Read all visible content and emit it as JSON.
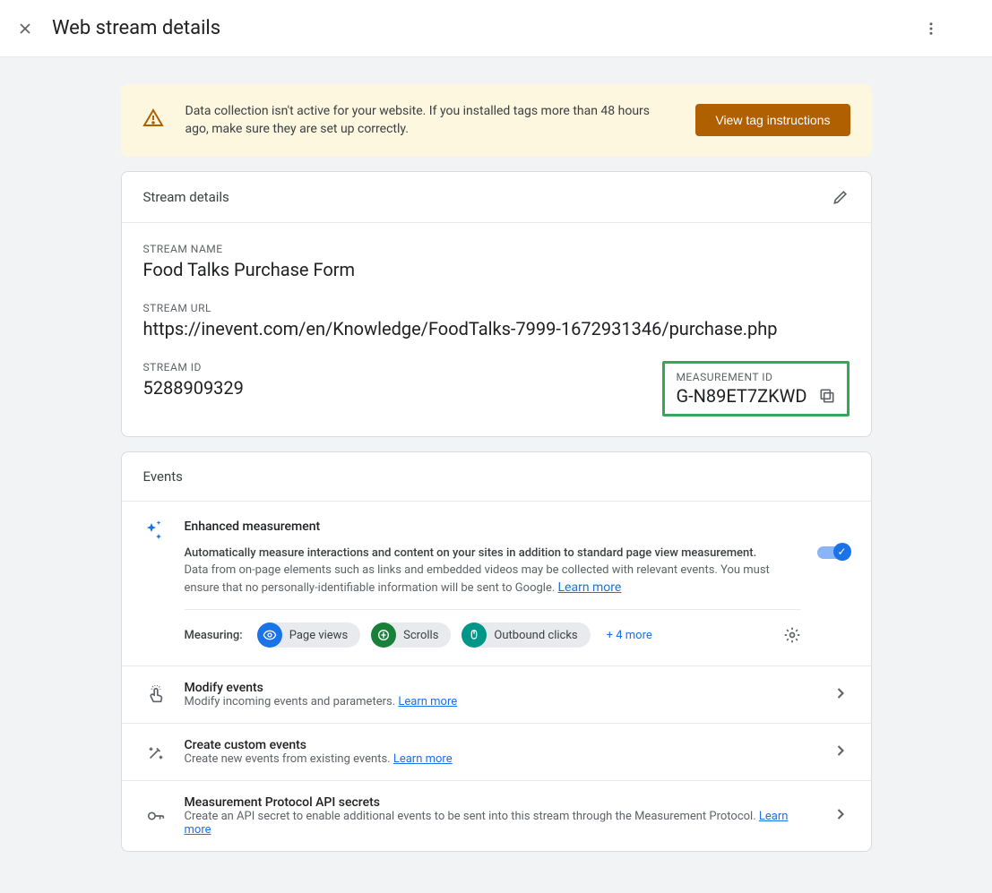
{
  "header": {
    "title": "Web stream details"
  },
  "alert": {
    "text": "Data collection isn't active for your website. If you installed tags more than 48 hours ago, make sure they are set up correctly.",
    "button": "View tag instructions"
  },
  "stream_details": {
    "card_title": "Stream details",
    "name_label": "STREAM NAME",
    "name_value": "Food Talks Purchase Form",
    "url_label": "STREAM URL",
    "url_value": "https://inevent.com/en/Knowledge/FoodTalks-7999-1672931346/purchase.php",
    "id_label": "STREAM ID",
    "id_value": "5288909329",
    "measurement_label": "MEASUREMENT ID",
    "measurement_value": "G-N89ET7ZKWD"
  },
  "events": {
    "card_title": "Events",
    "enhanced": {
      "title": "Enhanced measurement",
      "desc_bold": "Automatically measure interactions and content on your sites in addition to standard page view measurement.",
      "desc": "Data from on-page elements such as links and embedded videos may be collected with relevant events. You must ensure that no personally-identifiable information will be sent to Google. ",
      "learn_more": "Learn more",
      "measuring_label": "Measuring:",
      "chips": {
        "page_views": "Page views",
        "scrolls": "Scrolls",
        "outbound": "Outbound clicks"
      },
      "more": "+ 4 more"
    },
    "rows": {
      "modify": {
        "title": "Modify events",
        "sub": "Modify incoming events and parameters. ",
        "learn": "Learn more"
      },
      "create": {
        "title": "Create custom events",
        "sub": "Create new events from existing events. ",
        "learn": "Learn more"
      },
      "mp": {
        "title": "Measurement Protocol API secrets",
        "sub": "Create an API secret to enable additional events to be sent into this stream through the Measurement Protocol. ",
        "learn": "Learn more"
      }
    }
  }
}
